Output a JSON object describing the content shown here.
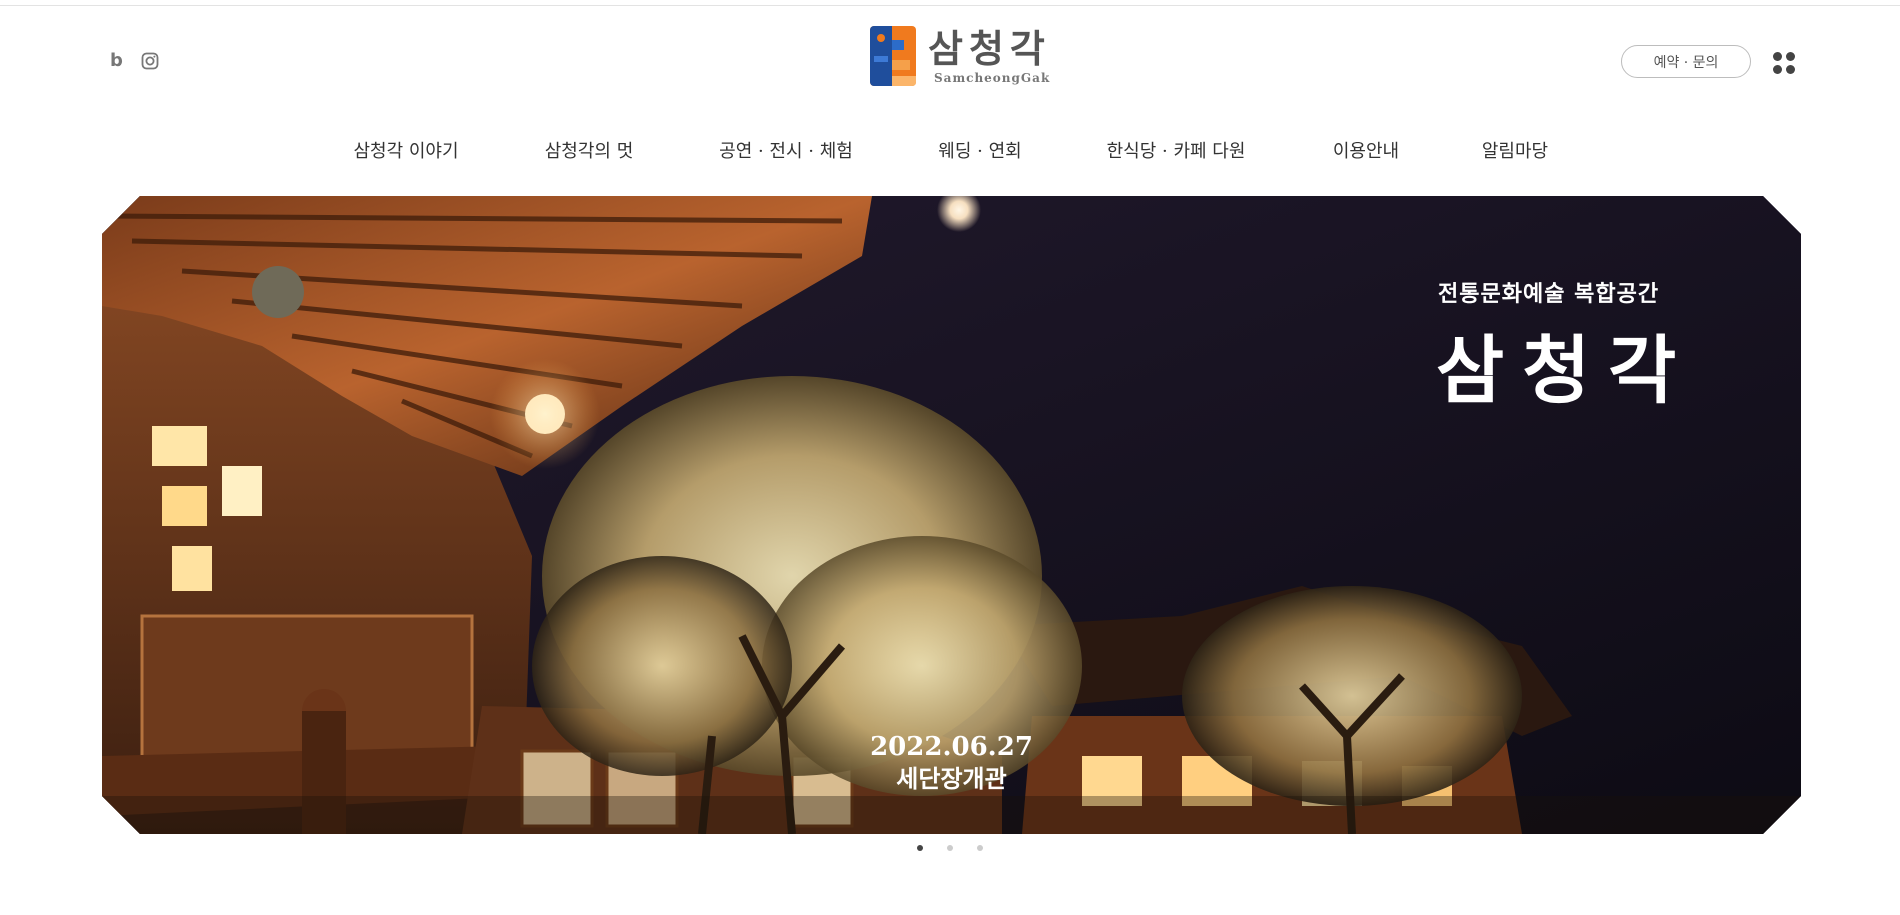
{
  "header": {
    "social": {
      "blog_label": "b",
      "blog_icon": "blog-icon",
      "instagram_icon": "instagram-icon"
    },
    "logo": {
      "name_ko": "삼청각",
      "name_en": "SamcheongGak"
    },
    "reserve_button": "예약 · 문의",
    "menu_icon": "grid-dots-icon"
  },
  "nav": {
    "items": [
      {
        "label": "삼청각 이야기"
      },
      {
        "label": "삼청각의 멋"
      },
      {
        "label": "공연 · 전시 · 체험"
      },
      {
        "label": "웨딩 · 연회"
      },
      {
        "label": "한식당 · 카페 다원"
      },
      {
        "label": "이용안내"
      },
      {
        "label": "알림마당"
      }
    ]
  },
  "hero": {
    "subtitle": "전통문화예술 복합공간",
    "title": "삼청각",
    "date": "2022.06.27",
    "caption": "세단장개관"
  },
  "slider": {
    "slide_count": 3,
    "active_index": 0
  },
  "colors": {
    "logo_blue": "#1f4e9c",
    "logo_orange": "#f07a1e",
    "sky": "#15111f",
    "warm_light": "#e79a4d"
  }
}
